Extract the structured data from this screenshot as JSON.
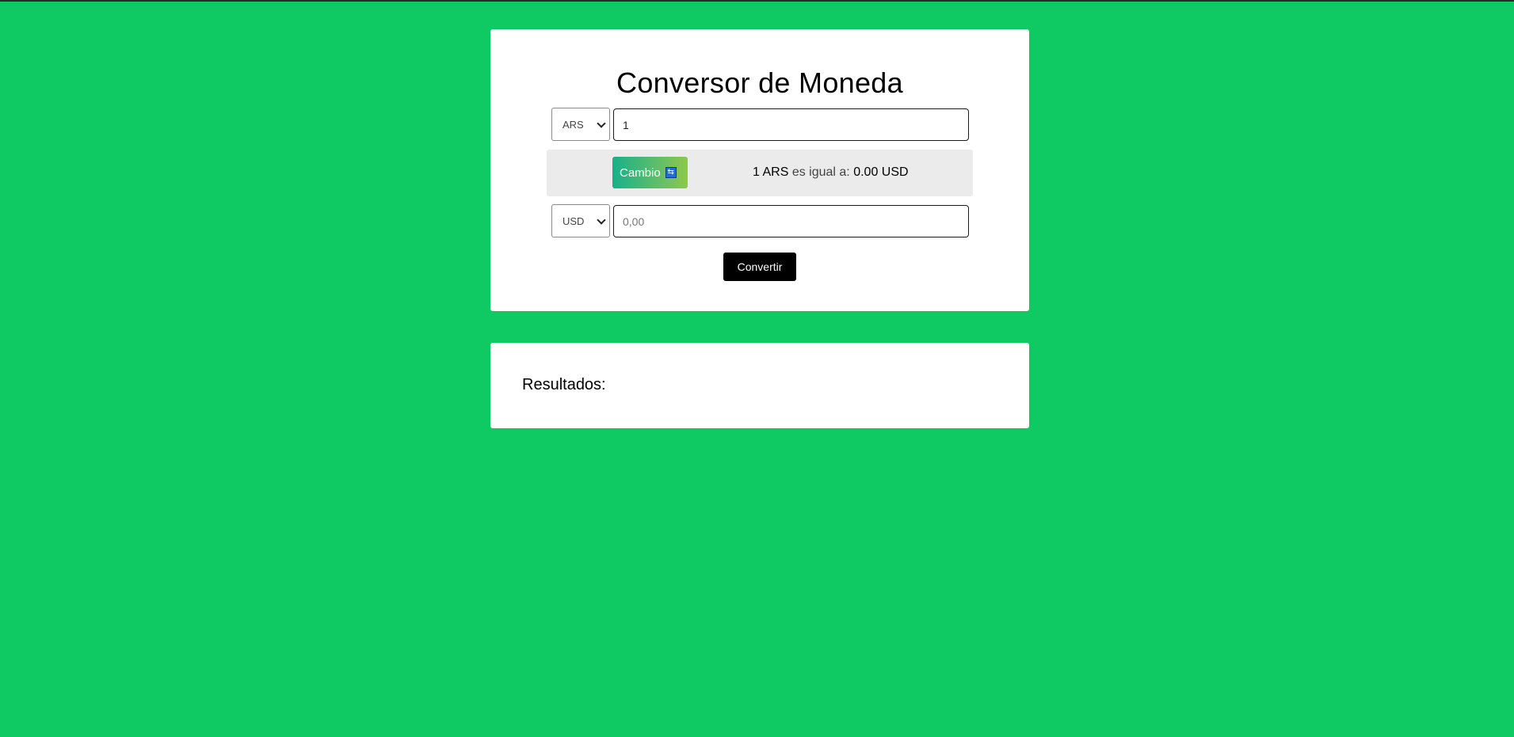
{
  "converter": {
    "title": "Conversor de Moneda",
    "from": {
      "currency": "ARS",
      "amount": "1"
    },
    "to": {
      "currency": "USD",
      "amount_placeholder": "0,00"
    },
    "swap_button_label": "Cambio",
    "swap_icon": "swap-arrows-icon",
    "rate": {
      "amount_from": "1 ARS",
      "connector": "es igual a:",
      "amount_to": "0.00 USD"
    },
    "convert_button_label": "Convertir"
  },
  "results": {
    "label": "Resultados:"
  },
  "colors": {
    "background": "#0fc962",
    "card": "#ffffff",
    "rate_bar": "#ebebeb",
    "convert_button": "#000000",
    "swap_gradient_start": "#18b08a",
    "swap_gradient_end": "#8fc84a"
  }
}
